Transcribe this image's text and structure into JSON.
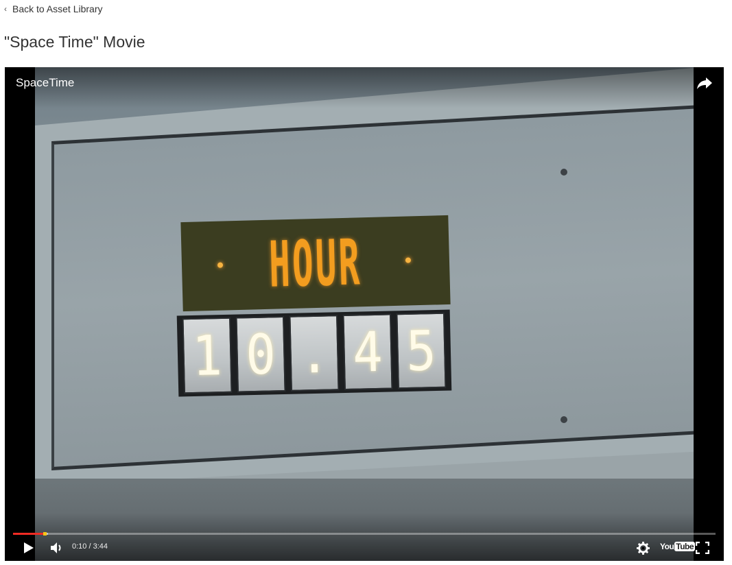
{
  "nav": {
    "back_label": "Back to Asset Library",
    "back_icon": "chevron-left-icon"
  },
  "page": {
    "title": "\"Space Time\" Movie"
  },
  "player": {
    "video_title": "SpaceTime",
    "current_time": "0:10",
    "duration": "3:44",
    "time_display": "0:10 / 3:44",
    "progress_fraction": 0.045,
    "buffered_fraction": 0.05,
    "accent_color": "#f12b24",
    "brand_logo": {
      "you": "You",
      "tube": "Tube"
    },
    "icons": [
      "share-icon",
      "play-icon",
      "volume-icon",
      "settings-gear-icon",
      "youtube-logo",
      "fullscreen-icon"
    ]
  },
  "video_content": {
    "sign_label": "HOUR",
    "clock_digits": [
      "1",
      "0",
      ".",
      "4",
      "5"
    ]
  }
}
